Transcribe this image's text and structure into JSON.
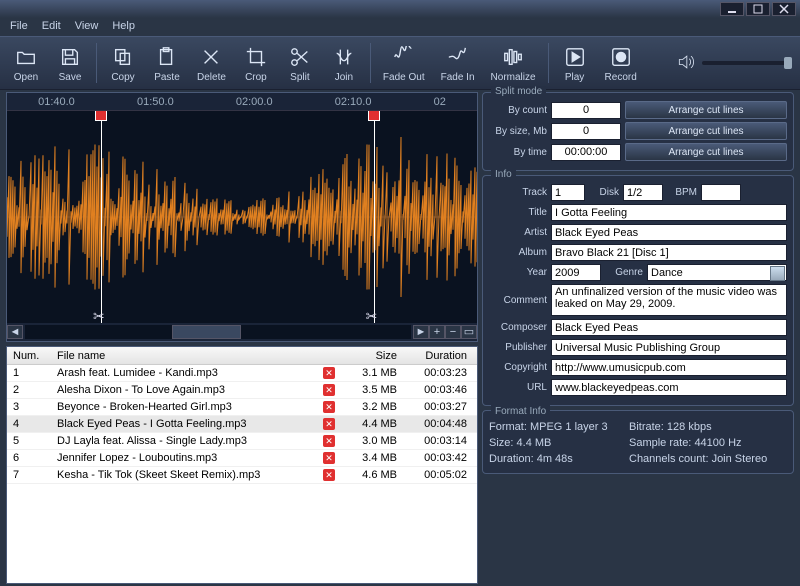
{
  "menu": {
    "file": "File",
    "edit": "Edit",
    "view": "View",
    "help": "Help"
  },
  "toolbar": {
    "open": "Open",
    "save": "Save",
    "copy": "Copy",
    "paste": "Paste",
    "delete": "Delete",
    "crop": "Crop",
    "split": "Split",
    "join": "Join",
    "fadeout": "Fade Out",
    "fadein": "Fade In",
    "normalize": "Normalize",
    "play": "Play",
    "record": "Record"
  },
  "timeline": {
    "t1": "01:40.0",
    "t2": "01:50.0",
    "t3": "02:00.0",
    "t4": "02:10.0",
    "t5": "02"
  },
  "split": {
    "title": "Split mode",
    "bycount_lbl": "By count",
    "bycount_val": "0",
    "bysize_lbl": "By size, Mb",
    "bysize_val": "0",
    "bytime_lbl": "By time",
    "bytime_val": "00:00:00",
    "arrange": "Arrange cut lines"
  },
  "info": {
    "title": "Info",
    "track_lbl": "Track",
    "track_val": "1",
    "disk_lbl": "Disk",
    "disk_val": "1/2",
    "bpm_lbl": "BPM",
    "bpm_val": "",
    "title_lbl": "Title",
    "title_val": "I Gotta Feeling",
    "artist_lbl": "Artist",
    "artist_val": "Black Eyed Peas",
    "album_lbl": "Album",
    "album_val": "Bravo Black 21 [Disc 1]",
    "year_lbl": "Year",
    "year_val": "2009",
    "genre_lbl": "Genre",
    "genre_val": "Dance",
    "comment_lbl": "Comment",
    "comment_val": "An unfinalized version of the music video was leaked on May 29, 2009.",
    "composer_lbl": "Composer",
    "composer_val": "Black Eyed Peas",
    "publisher_lbl": "Publisher",
    "publisher_val": "Universal Music Publishing Group",
    "copyright_lbl": "Copyright",
    "copyright_val": "http://www.umusicpub.com",
    "url_lbl": "URL",
    "url_val": "www.blackeyedpeas.com"
  },
  "format": {
    "title": "Format Info",
    "format_lbl": "Format:",
    "format_val": "MPEG 1 layer 3",
    "bitrate_lbl": "Bitrate:",
    "bitrate_val": "128 kbps",
    "size_lbl": "Size:",
    "size_val": "4.4 MB",
    "sample_lbl": "Sample rate:",
    "sample_val": "44100 Hz",
    "duration_lbl": "Duration:",
    "duration_val": "4m 48s",
    "channels_lbl": "Channels count:",
    "channels_val": "Join Stereo"
  },
  "list": {
    "h_num": "Num.",
    "h_name": "File name",
    "h_size": "Size",
    "h_dur": "Duration",
    "rows": [
      {
        "num": "1",
        "name": "Arash feat. Lumidee - Kandi.mp3",
        "size": "3.1 MB",
        "dur": "00:03:23"
      },
      {
        "num": "2",
        "name": "Alesha Dixon - To Love Again.mp3",
        "size": "3.5 MB",
        "dur": "00:03:46"
      },
      {
        "num": "3",
        "name": "Beyonce - Broken-Hearted Girl.mp3",
        "size": "3.2 MB",
        "dur": "00:03:27"
      },
      {
        "num": "4",
        "name": "Black Eyed Peas - I Gotta Feeling.mp3",
        "size": "4.4 MB",
        "dur": "00:04:48"
      },
      {
        "num": "5",
        "name": "DJ Layla feat. Alissa - Single Lady.mp3",
        "size": "3.0 MB",
        "dur": "00:03:14"
      },
      {
        "num": "6",
        "name": "Jennifer Lopez - Louboutins.mp3",
        "size": "3.4 MB",
        "dur": "00:03:42"
      },
      {
        "num": "7",
        "name": "Kesha - Tik Tok (Skeet Skeet Remix).mp3",
        "size": "4.6 MB",
        "dur": "00:05:02"
      }
    ],
    "selected": 3
  }
}
